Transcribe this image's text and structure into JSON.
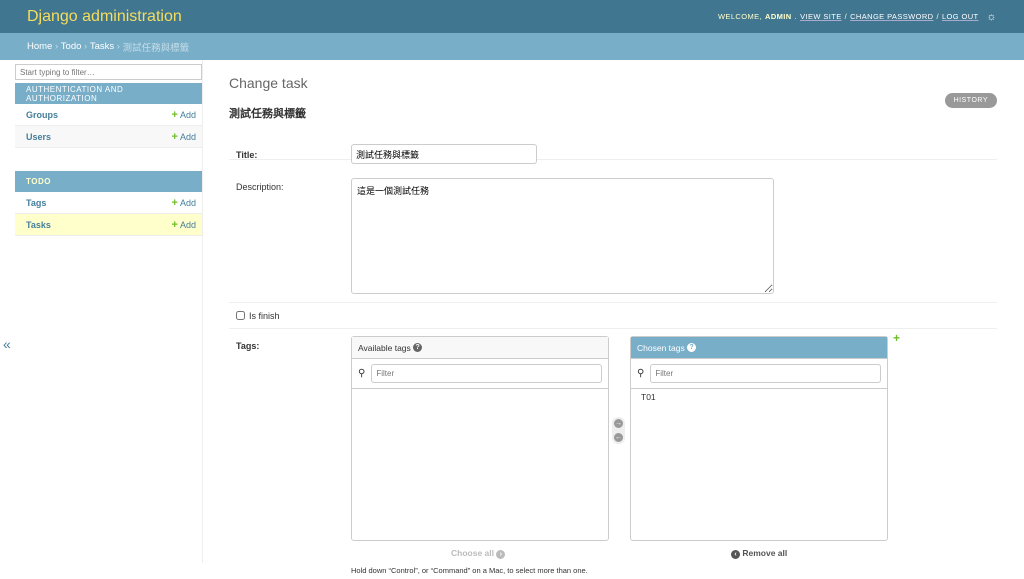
{
  "header": {
    "brand": "Django administration",
    "welcome": "WELCOME, ",
    "user": "ADMIN",
    "view_site": "VIEW SITE",
    "change_password": "CHANGE PASSWORD",
    "logout": "LOG OUT",
    "sep": "/"
  },
  "breadcrumbs": [
    "Home",
    "Todo",
    "Tasks",
    "測試任務與標籤"
  ],
  "sidebar": {
    "filter_placeholder": "Start typing to filter…",
    "modules": [
      {
        "caption": "AUTHENTICATION AND AUTHORIZATION",
        "rows": [
          {
            "label": "Groups",
            "add": "Add"
          },
          {
            "label": "Users",
            "add": "Add"
          }
        ]
      },
      {
        "caption": "TODO",
        "rows": [
          {
            "label": "Tags",
            "add": "Add"
          },
          {
            "label": "Tasks",
            "add": "Add"
          }
        ]
      }
    ],
    "collapse": "«"
  },
  "main": {
    "title": "Change task",
    "object": "測試任務與標籤",
    "history": "HISTORY",
    "fields": {
      "title_label": "Title:",
      "title_value": "測試任務與標籤",
      "desc_label": "Description:",
      "desc_value": "這是一個測試任務",
      "finish_label": "Is finish",
      "tags_label": "Tags:"
    },
    "selector": {
      "available": "Available tags",
      "chosen": "Chosen tags",
      "filter_placeholder": "Filter",
      "chosen_items": [
        "T01"
      ],
      "choose_all": "Choose all",
      "remove_all": "Remove all",
      "help": "Hold down “Control”, or “Command” on a Mac, to select more than one."
    }
  }
}
